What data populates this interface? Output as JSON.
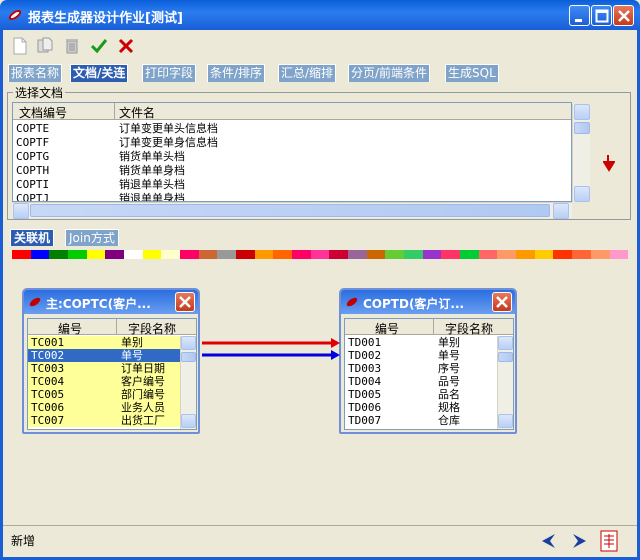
{
  "window": {
    "title": "报表生成器设计作业[测试]"
  },
  "colors": {
    "titlebar": "#0a5fd8",
    "selected": "#316ac5",
    "yellow": "#ffff99",
    "arrow_red": "#e00000",
    "arrow_blue": "#0000e0"
  },
  "toolbar": {
    "items": [
      {
        "name": "new-icon"
      },
      {
        "name": "copy-icon"
      },
      {
        "name": "delete-icon"
      },
      {
        "name": "confirm-icon"
      },
      {
        "name": "cancel-icon"
      }
    ]
  },
  "tabs": [
    {
      "label": "报表名称",
      "active": false
    },
    {
      "label": "文档/关连",
      "active": true
    },
    {
      "label": "打印字段",
      "active": false
    },
    {
      "label": "条件/排序",
      "active": false
    },
    {
      "label": "汇总/缩排",
      "active": false
    },
    {
      "label": "分页/前端条件",
      "active": false
    },
    {
      "label": "生成SQL",
      "active": false
    }
  ],
  "select_doc": {
    "group_label": "选择文档",
    "col_code": "文档编号",
    "col_name": "文件名",
    "rows": [
      {
        "code": "COPTE",
        "name": "订单变更单头信息档"
      },
      {
        "code": "COPTF",
        "name": "订单变更单身信息档"
      },
      {
        "code": "COPTG",
        "name": "销货单单头档"
      },
      {
        "code": "COPTH",
        "name": "销货单单身档"
      },
      {
        "code": "COPTI",
        "name": "销退单单头档"
      },
      {
        "code": "COPTJ",
        "name": "销退单单身档"
      }
    ]
  },
  "lower_tabs": [
    {
      "label": "关联机",
      "active": true
    },
    {
      "label": "Join方式",
      "active": false
    }
  ],
  "color_strip": [
    "#ff0000",
    "#0000ff",
    "#008000",
    "#00cc00",
    "#ffff00",
    "#800080",
    "#ffffff",
    "#ffff00",
    "#ffffcc",
    "#ff0066",
    "#cc6633",
    "#999999",
    "#cc0000",
    "#ff9900",
    "#ff6600",
    "#ff0066",
    "#ff3399",
    "#cc0033",
    "#996699",
    "#cc6600",
    "#66cc33",
    "#33cc66",
    "#9933cc",
    "#ff3366",
    "#00cc33",
    "#ff6666",
    "#ff9966",
    "#ff9900",
    "#ffcc00",
    "#ff3300",
    "#ff6633",
    "#ff9966",
    "#ff99cc"
  ],
  "table_main": {
    "title": "主:COPTC(客户...",
    "col_code": "编号",
    "col_name": "字段名称",
    "rows": [
      {
        "code": "TC001",
        "name": "单别",
        "selected": false
      },
      {
        "code": "TC002",
        "name": "单号",
        "selected": true
      },
      {
        "code": "TC003",
        "name": "订单日期",
        "selected": false
      },
      {
        "code": "TC004",
        "name": "客户编号",
        "selected": false
      },
      {
        "code": "TC005",
        "name": "部门编号",
        "selected": false
      },
      {
        "code": "TC006",
        "name": "业务人员",
        "selected": false
      },
      {
        "code": "TC007",
        "name": "出货工厂",
        "selected": false
      }
    ]
  },
  "table_sub": {
    "title": "COPTD(客户订...",
    "col_code": "编号",
    "col_name": "字段名称",
    "rows": [
      {
        "code": "TD001",
        "name": "单别"
      },
      {
        "code": "TD002",
        "name": "单号"
      },
      {
        "code": "TD003",
        "name": "序号"
      },
      {
        "code": "TD004",
        "name": "品号"
      },
      {
        "code": "TD005",
        "name": "品名"
      },
      {
        "code": "TD006",
        "name": "规格"
      },
      {
        "code": "TD007",
        "name": "仓库"
      }
    ]
  },
  "status": {
    "text": "新增"
  }
}
